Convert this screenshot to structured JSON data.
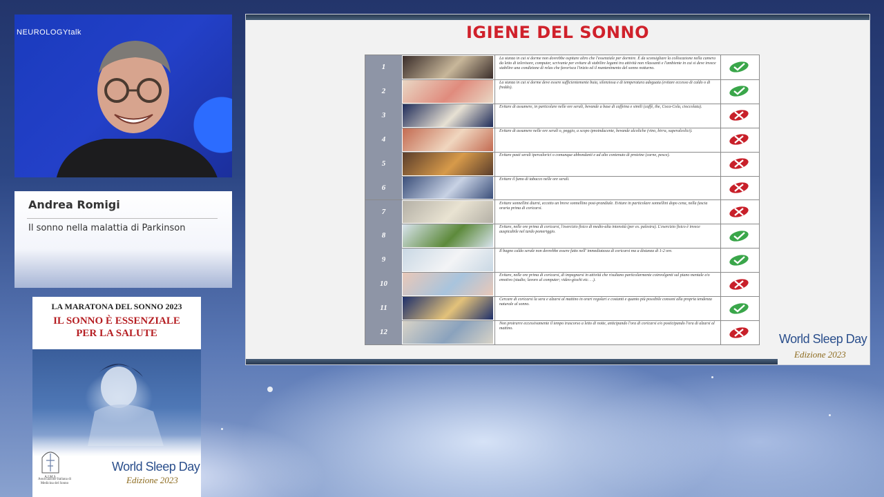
{
  "video": {
    "brand": "NEUROLOGYtalk"
  },
  "speaker": {
    "name": "Andrea Romigi",
    "talk_title": "Il sonno nella malattia di Parkinson"
  },
  "poster": {
    "line1": "LA MARATONA DEL SONNO 2023",
    "line2a": "IL SONNO È ESSENZIALE",
    "line2b": "PER LA SALUTE",
    "assoc": "Associazione Italiana di Medicina del Sonno",
    "assoc_short": "A.I.M.S.",
    "wsd": "World Sleep Day",
    "edition": "Edizione 2023"
  },
  "slide": {
    "title": "IGIENE DEL SONNO",
    "wsd": "World Sleep Day",
    "edition": "Edizione 2023",
    "rows": [
      {
        "n": "1",
        "text": "La stanza in cui si dorme non dovrebbe ospitare altro che l'essenziale per dormire. È da sconsigliare la collocazione nella camera da letto di televisore, computer, scrivanie per evitare di stabilire legami tra attività non rilassanti e l'ambiente in cui si deve invece stabilire una condizione di relax che favorisca l'inizio ed il mantenimento del sonno notturno.",
        "ok": true
      },
      {
        "n": "2",
        "text": "La stanza in cui si dorme deve essere sufficientemente buia, silenziosa e di temperatura adeguata (evitare eccesso di caldo o di freddo).",
        "ok": true
      },
      {
        "n": "3",
        "text": "Evitare di assumere, in particolare nelle ore serali, bevande a base di caffeina e simili (caffè, the, Coca-Cola, cioccolata).",
        "ok": false
      },
      {
        "n": "4",
        "text": "Evitare di assumere nelle ore serali o, peggio, a scopo ipnoinducente, bevande alcoliche (vino, birra, superalcolici).",
        "ok": false
      },
      {
        "n": "5",
        "text": "Evitare pasti serali ipercalorici o comunque abbondanti e ad alto contenuto di proteine (carne, pesce).",
        "ok": false
      },
      {
        "n": "6",
        "text": "Evitare il fumo di tabacco nelle ore serali.",
        "ok": false
      },
      {
        "n": "7",
        "text": "Evitare sonnellini diurni, eccetto un breve sonnellino post-prandiale. Evitare in particolare sonnellini dopo cena, nella fascia oraria prima di coricarsi.",
        "ok": false
      },
      {
        "n": "8",
        "text": "Evitare, nelle ore prima di coricarsi, l'esercizio fisico di medio-alta intensità (per es. palestra). L'esercizio fisico è invece auspicabile nel tardo pomeriggio.",
        "ok": true
      },
      {
        "n": "9",
        "text": "Il bagno caldo serale non dovrebbe essere fatto nell' immediatezza di coricarsi ma a distanza di 1-2 ore.",
        "ok": true
      },
      {
        "n": "10",
        "text": "Evitare, nelle ore prima di coricarsi, di impegnarsi in attività che risultano particolarmente coinvolgenti sul piano mentale e/o emotivo (studio; lavoro al computer; video-giochi etc. . .).",
        "ok": false
      },
      {
        "n": "11",
        "text": "Cercare di coricarsi la sera e alzarsi al mattino in orari regolari e costanti e quanto più possibile consoni alla propria tendenza naturale al sonno.",
        "ok": true
      },
      {
        "n": "12",
        "text": "Non protrarre eccessivamente il tempo trascorso a letto di notte, anticipando l'ora di coricarsi e/o posticipando l'ora di alzarsi al mattino.",
        "ok": false
      }
    ]
  },
  "colors": {
    "title_red": "#d0212b",
    "ok_green": "#3aa64a",
    "no_red": "#c8202a"
  }
}
